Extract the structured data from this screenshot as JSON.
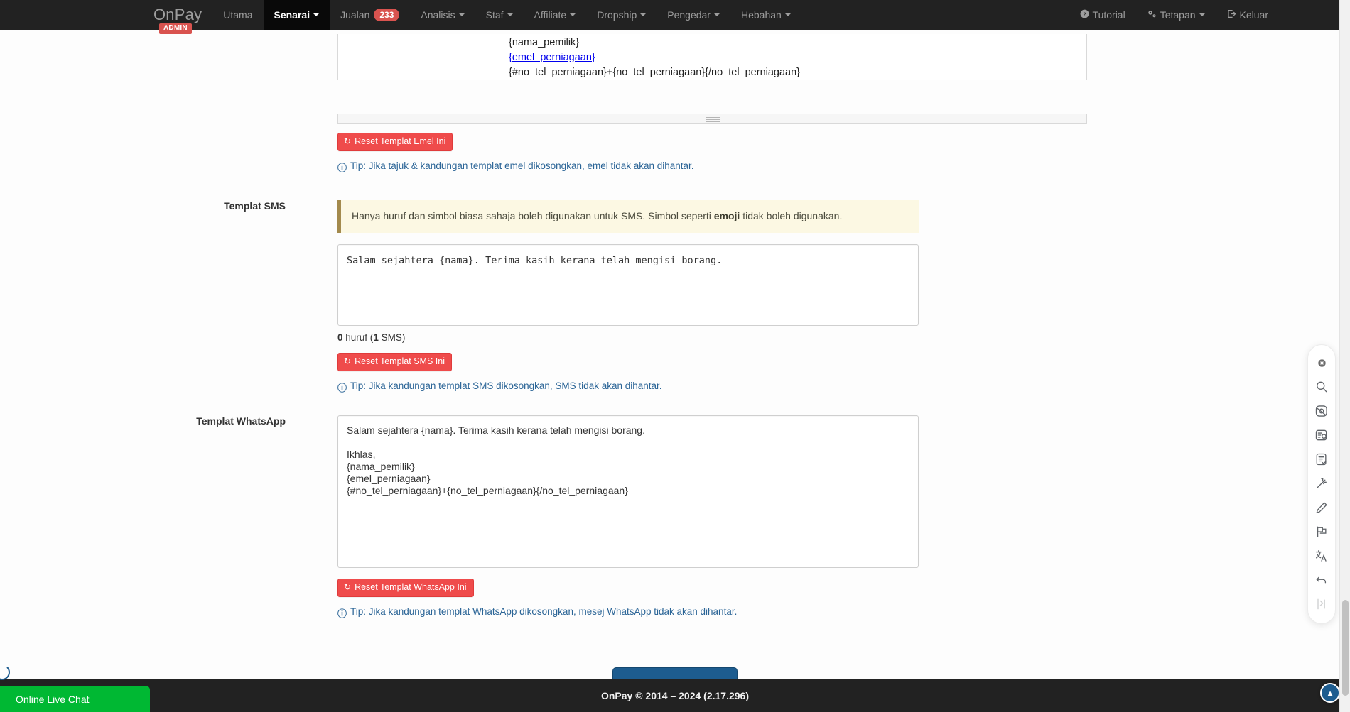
{
  "navbar": {
    "brand": "OnPay",
    "brand_badge": "ADMIN",
    "left_items": [
      {
        "label": "Utama",
        "caret": false,
        "active": false,
        "badge": null
      },
      {
        "label": "Senarai",
        "caret": true,
        "active": true,
        "badge": null
      },
      {
        "label": "Jualan",
        "caret": false,
        "active": false,
        "badge": "233"
      },
      {
        "label": "Analisis",
        "caret": true,
        "active": false,
        "badge": null
      },
      {
        "label": "Staf",
        "caret": true,
        "active": false,
        "badge": null
      },
      {
        "label": "Affiliate",
        "caret": true,
        "active": false,
        "badge": null
      },
      {
        "label": "Dropship",
        "caret": true,
        "active": false,
        "badge": null
      },
      {
        "label": "Pengedar",
        "caret": true,
        "active": false,
        "badge": null
      },
      {
        "label": "Hebahan",
        "caret": true,
        "active": false,
        "badge": null
      }
    ],
    "right_items": [
      {
        "label": "Tutorial",
        "icon": "question-circle-icon",
        "glyph": "ⓘ",
        "caret": false
      },
      {
        "label": "Tetapan",
        "icon": "gears-icon",
        "glyph": "⚙",
        "caret": true
      },
      {
        "label": "Keluar",
        "icon": "logout-icon",
        "glyph": "↪",
        "caret": false
      }
    ],
    "accent_red": "#d9534f",
    "bg": "#222222"
  },
  "email_section": {
    "lines": [
      "{nama_pemilik}",
      "{emel_perniagaan}",
      "{#no_tel_perniagaan}+{no_tel_perniagaan}{/no_tel_perniagaan}"
    ],
    "link_line": "{emel_perniagaan}",
    "reset_label": "Reset Templat Emel Ini",
    "tip": "Tip: Jika tajuk & kandungan templat emel dikosongkan, emel tidak akan dihantar."
  },
  "sms_section": {
    "label": "Templat SMS",
    "alert_prefix": "Hanya huruf dan simbol biasa sahaja boleh digunakan untuk SMS. Simbol seperti ",
    "alert_bold": "emoji",
    "alert_suffix": " tidak boleh digunakan.",
    "textarea_value": "Salam sejahtera {nama}. Terima kasih kerana telah mengisi borang.",
    "counter_count": "0",
    "counter_unit": "huruf (",
    "counter_sms": "1",
    "counter_tail": " SMS)",
    "reset_label": "Reset Templat SMS Ini",
    "tip": "Tip: Jika kandungan templat SMS dikosongkan, SMS tidak akan dihantar."
  },
  "whatsapp_section": {
    "label": "Templat WhatsApp",
    "textarea_value": "Salam sejahtera {nama}. Terima kasih kerana telah mengisi borang.\n\nIkhlas,\n{nama_pemilik}\n{emel_perniagaan}\n{#no_tel_perniagaan}+{no_tel_perniagaan}{/no_tel_perniagaan}",
    "reset_label": "Reset Templat WhatsApp Ini",
    "tip": "Tip: Jika kandungan templat WhatsApp dikosongkan, mesej WhatsApp tidak akan dihantar."
  },
  "save": {
    "label": "Simpan Borang",
    "color": "#1d5c8f"
  },
  "footer": {
    "text": "OnPay © 2014 – 2024 (2.17.296)"
  },
  "live_chat": {
    "label": "Online Live Chat",
    "color": "#00b833"
  },
  "tool_rail": {
    "items": [
      {
        "name": "close-icon",
        "label": "Tutup"
      },
      {
        "name": "search-icon",
        "label": "Cari"
      },
      {
        "name": "image-search-icon",
        "label": "Cari Imej"
      },
      {
        "name": "document-search-icon",
        "label": "Cari Dokumen"
      },
      {
        "name": "document-check-icon",
        "label": "Semak Dokumen"
      },
      {
        "name": "magic-wand-icon",
        "label": "Magik"
      },
      {
        "name": "pencil-icon",
        "label": "Edit"
      },
      {
        "name": "flag-icon",
        "label": "Bendera"
      },
      {
        "name": "translate-icon",
        "label": "Terjemah"
      },
      {
        "name": "undo-icon",
        "label": "Buat Asal"
      },
      {
        "name": "split-icon",
        "label": "Pisah"
      }
    ]
  },
  "scroll_top": {
    "label": "Ke Atas"
  }
}
